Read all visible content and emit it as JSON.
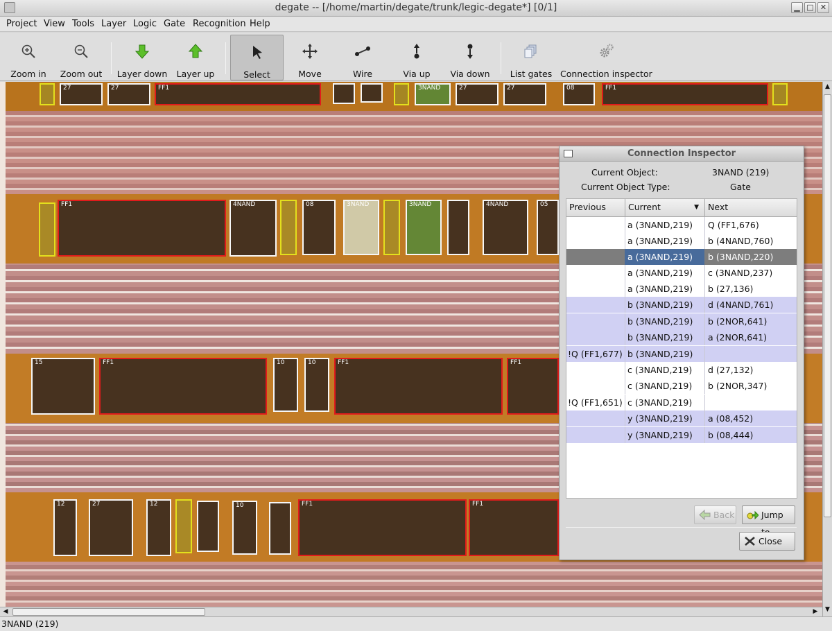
{
  "window": {
    "title": "degate -- [/home/martin/degate/trunk/legic-degate*] [0/1]"
  },
  "menu": [
    "Project",
    "View",
    "Tools",
    "Layer",
    "Logic",
    "Gate",
    "Recognition",
    "Help"
  ],
  "toolbar": {
    "zoom_in": "Zoom in",
    "zoom_out": "Zoom out",
    "layer_down": "Layer down",
    "layer_up": "Layer up",
    "select": "Select",
    "move": "Move",
    "wire": "Wire",
    "via_up": "Via up",
    "via_down": "Via down",
    "list_gates": "List gates",
    "connection_inspector": "Connection inspector",
    "active_tool": "Select"
  },
  "canvas": {
    "gate_labels": [
      "27",
      "27",
      "FF1",
      "3NAND",
      "27",
      "27",
      "08",
      "FF1",
      "FF1",
      "4NAND",
      "08",
      "3NAND",
      "3NAND",
      "4NAND",
      "05",
      "15",
      "FF1",
      "10",
      "10",
      "FF1",
      "FF1",
      "12",
      "27",
      "12",
      "10",
      "FF1",
      "FF1"
    ]
  },
  "dialog": {
    "title": "Connection Inspector",
    "current_object_label": "Current Object:",
    "current_object_value": "3NAND (219)",
    "current_object_type_label": "Current Object Type:",
    "current_object_type_value": "Gate",
    "columns": {
      "previous": "Previous",
      "current": "Current",
      "next": "Next"
    },
    "rows": [
      {
        "previous": "",
        "current": "a (3NAND,219)",
        "next": "Q (FF1,676)"
      },
      {
        "previous": "",
        "current": "a (3NAND,219)",
        "next": "b (4NAND,760)"
      },
      {
        "previous": "",
        "current": "a (3NAND,219)",
        "next": "b (3NAND,220)"
      },
      {
        "previous": "",
        "current": "a (3NAND,219)",
        "next": "c (3NAND,237)"
      },
      {
        "previous": "",
        "current": "a (3NAND,219)",
        "next": "b (27,136)"
      },
      {
        "previous": "",
        "current": "b (3NAND,219)",
        "next": "d (4NAND,761)"
      },
      {
        "previous": "",
        "current": "b (3NAND,219)",
        "next": "b (2NOR,641)"
      },
      {
        "previous": "",
        "current": "b (3NAND,219)",
        "next": "a (2NOR,641)"
      },
      {
        "previous": "!Q (FF1,677)",
        "current": "b (3NAND,219)",
        "next": ""
      },
      {
        "previous": "",
        "current": "c (3NAND,219)",
        "next": "d (27,132)"
      },
      {
        "previous": "",
        "current": "c (3NAND,219)",
        "next": "b (2NOR,347)"
      },
      {
        "previous": "!Q (FF1,651)",
        "current": "c (3NAND,219)",
        "next": ""
      },
      {
        "previous": "",
        "current": "y (3NAND,219)",
        "next": "a (08,452)"
      },
      {
        "previous": "",
        "current": "y (3NAND,219)",
        "next": "b (08,444)"
      }
    ],
    "selected_row": 3,
    "back_label": "Back",
    "jump_label": "Jump to",
    "close_label": "Close"
  },
  "status": {
    "text": "3NAND (219)"
  },
  "colors": {
    "selection": "#486b9b",
    "row_alt": "#d0d0f3",
    "gate_border": "#f6f6f6",
    "ff_border": "#e11b1b",
    "filler_border": "#e3e01d"
  }
}
